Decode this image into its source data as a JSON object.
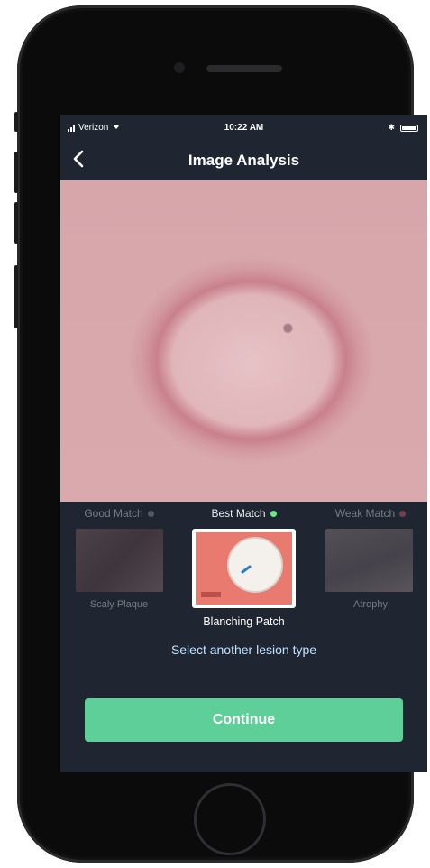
{
  "statusbar": {
    "carrier": "Verizon",
    "time": "10:22 AM"
  },
  "navbar": {
    "title": "Image Analysis"
  },
  "matches": {
    "left": {
      "header": "Good Match",
      "label": "Scaly Plaque",
      "dot_color": "#9aa3ad"
    },
    "center": {
      "header": "Best Match",
      "label": "Blanching Patch",
      "dot_color": "#6ee68f"
    },
    "right": {
      "header": "Weak Match",
      "label": "Atrophy",
      "dot_color": "#e06a6a"
    }
  },
  "select_link": "Select another lesion type",
  "continue_label": "Continue",
  "colors": {
    "accent": "#5fcf9a",
    "screen_bg": "#1f2631",
    "link": "#bfe3ff"
  }
}
